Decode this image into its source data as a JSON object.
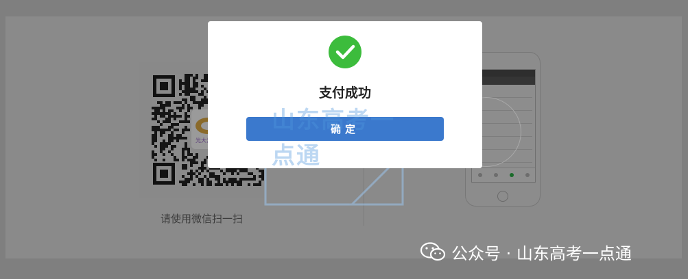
{
  "payment_page": {
    "qr_caption": "请使用微信扫一扫"
  },
  "modal": {
    "icon": "check-circle-icon",
    "title": "支付成功",
    "confirm_label": "确定",
    "accent_color": "#3b79cd",
    "success_color": "#3cbc3c"
  },
  "watermarks": {
    "logo_text": "山东高考一点通",
    "channel_text": "公众号 · 山东高考一点通",
    "channel_icon": "wechat-icon"
  }
}
